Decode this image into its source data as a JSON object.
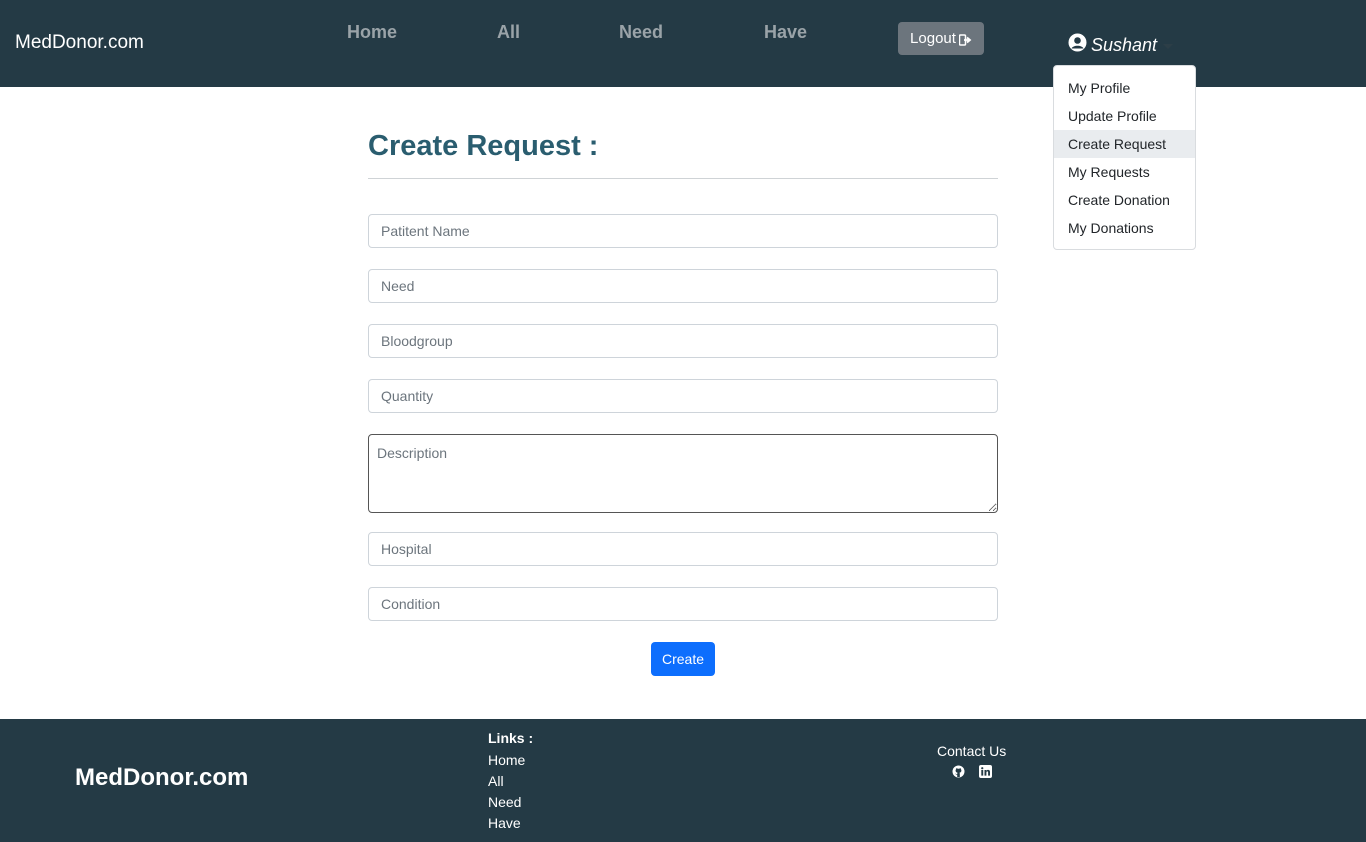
{
  "nav": {
    "brand": "MedDonor.com",
    "links": [
      "Home",
      "All",
      "Need",
      "Have"
    ],
    "logout_label": "Logout",
    "user_name": "Sushant"
  },
  "dropdown": {
    "items": [
      "My Profile",
      "Update Profile",
      "Create Request",
      "My Requests",
      "Create Donation",
      "My Donations"
    ],
    "active": "Create Request"
  },
  "form": {
    "title": "Create Request :",
    "placeholders": {
      "patient_name": "Patitent Name",
      "need": "Need",
      "bloodgroup": "Bloodgroup",
      "quantity": "Quantity",
      "description": "Description",
      "hospital": "Hospital",
      "condition": "Condition"
    },
    "submit_label": "Create"
  },
  "footer": {
    "brand": "MedDonor.com",
    "links_title": "Links :",
    "links": [
      "Home",
      "All",
      "Need",
      "Have"
    ],
    "contact_label": "Contact Us"
  },
  "colors": {
    "navbar_bg": "#243a45",
    "title_color": "#2a5d6f",
    "primary": "#0d6efd",
    "logout_bg": "#6c757d"
  }
}
